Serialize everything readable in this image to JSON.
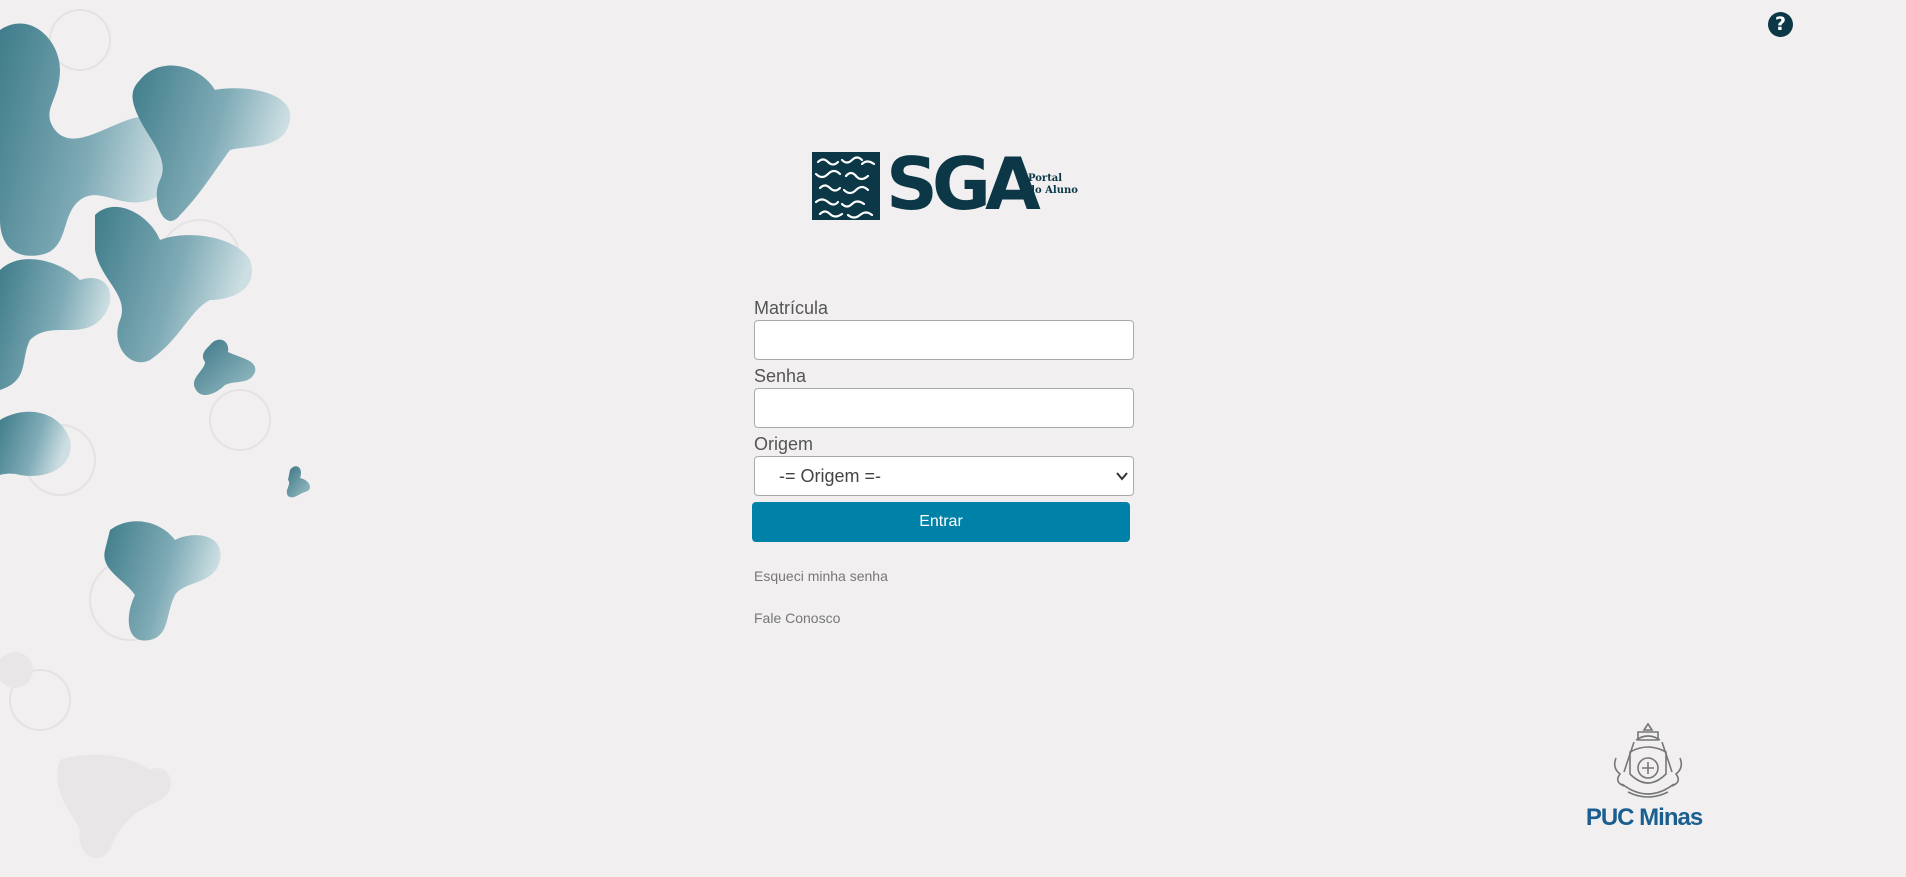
{
  "header": {
    "help_label": "?"
  },
  "logo": {
    "wordmark": "SGA",
    "subtitle_line1": "Portal",
    "subtitle_line2": "do Aluno"
  },
  "form": {
    "matricula": {
      "label": "Matrícula",
      "value": "",
      "placeholder": ""
    },
    "senha": {
      "label": "Senha",
      "value": "",
      "placeholder": ""
    },
    "origem": {
      "label": "Origem",
      "selected": "-= Origem =-"
    },
    "submit_label": "Entrar"
  },
  "links": {
    "forgot_password": "Esqueci minha senha",
    "contact": "Fale Conosco"
  },
  "footer": {
    "institution": "PUC Minas"
  },
  "colors": {
    "background": "#f1eff0",
    "primary_button": "#0082a8",
    "brand_dark": "#0c3747",
    "institution_blue": "#1a5f8f",
    "decor_teal": "#4a8a98"
  },
  "icons": {
    "help": "question-circle-icon",
    "select": "chevron-down-icon"
  }
}
